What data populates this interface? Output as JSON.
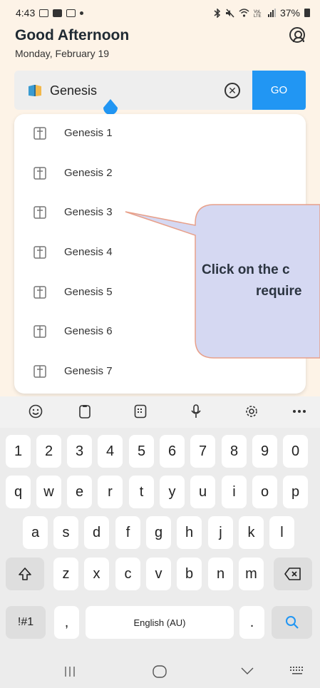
{
  "status_bar": {
    "time": "4:43",
    "battery": "37%"
  },
  "header": {
    "greeting": "Good Afternoon",
    "date": "Monday, February 19"
  },
  "search": {
    "value": "Genesis",
    "go_label": "GO"
  },
  "suggestions": [
    "Genesis 1",
    "Genesis 2",
    "Genesis 3",
    "Genesis 4",
    "Genesis 5",
    "Genesis 6",
    "Genesis 7"
  ],
  "callout": {
    "line1": "Click on the c",
    "line2": "require"
  },
  "keyboard": {
    "row_numbers": [
      "1",
      "2",
      "3",
      "4",
      "5",
      "6",
      "7",
      "8",
      "9",
      "0"
    ],
    "row_q": [
      "q",
      "w",
      "e",
      "r",
      "t",
      "y",
      "u",
      "i",
      "o",
      "p"
    ],
    "row_a": [
      "a",
      "s",
      "d",
      "f",
      "g",
      "h",
      "j",
      "k",
      "l"
    ],
    "row_z": [
      "z",
      "x",
      "c",
      "v",
      "b",
      "n",
      "m"
    ],
    "symbols_label": "!#1",
    "comma": ",",
    "space_label": "English (AU)",
    "period": "."
  },
  "colors": {
    "accent": "#2196f3",
    "callout_fill": "#d5d8f2",
    "callout_border": "#e8a08a",
    "background": "#fdf3e7"
  },
  "icons": {
    "toolbar": [
      "emoji-icon",
      "clipboard-icon",
      "keypad-icon",
      "microphone-icon",
      "settings-icon",
      "more-icon"
    ],
    "nav": [
      "recent-apps-icon",
      "home-icon",
      "back-icon",
      "keyboard-switch-icon"
    ]
  }
}
